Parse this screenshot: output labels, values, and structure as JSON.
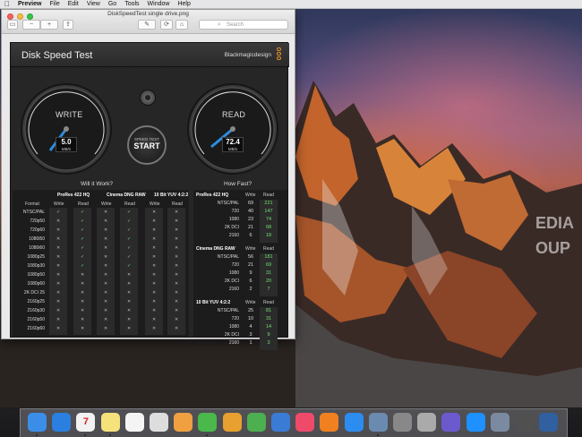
{
  "menubar": {
    "apple": "",
    "app": "Preview",
    "items": [
      "File",
      "Edit",
      "View",
      "Go",
      "Tools",
      "Window",
      "Help"
    ]
  },
  "window": {
    "title": "DiskSpeedTest single drive.png",
    "search_placeholder": "Search"
  },
  "dst": {
    "title": "Disk Speed Test",
    "brand": "Blackmagicdesign",
    "write": {
      "label": "WRITE",
      "value": "5.0",
      "unit": "MB/s"
    },
    "read": {
      "label": "READ",
      "value": "72.4",
      "unit": "MB/s"
    },
    "start": {
      "line1": "SPEED TEST",
      "line2": "START"
    },
    "will_it_work": "Will it Work?",
    "how_fast": "How Fast?",
    "format_label": "Format",
    "codecs": [
      "ProRes 422 HQ",
      "Cinema DNG RAW",
      "10 Bit YUV 4:2:2"
    ],
    "wr": [
      "Write",
      "Read"
    ],
    "formats": [
      "NTSC/PAL",
      "720p50",
      "720p60",
      "1080i50",
      "1080i60",
      "1080p25",
      "1080p30",
      "1080p50",
      "1080p60",
      "2K DCI 25",
      "2160p25",
      "2160p30",
      "2160p50",
      "2160p60"
    ],
    "how_fast_sections": [
      {
        "name": "ProRes 422 HQ",
        "rows": [
          [
            "NTSC/PAL",
            "69",
            "221"
          ],
          [
            "720",
            "40",
            "147"
          ],
          [
            "1080",
            "23",
            "74"
          ],
          [
            "2K DCI",
            "21",
            "68"
          ],
          [
            "2160",
            "6",
            "18"
          ]
        ]
      },
      {
        "name": "Cinema DNG RAW",
        "rows": [
          [
            "NTSC/PAL",
            "56",
            "181"
          ],
          [
            "720",
            "21",
            "69"
          ],
          [
            "1080",
            "9",
            "31"
          ],
          [
            "2K DCI",
            "6",
            "20"
          ],
          [
            "2160",
            "2",
            "7"
          ]
        ]
      },
      {
        "name": "10 Bit YUV 4:2:2",
        "rows": [
          [
            "NTSC/PAL",
            "25",
            "81"
          ],
          [
            "720",
            "10",
            "31"
          ],
          [
            "1080",
            "4",
            "14"
          ],
          [
            "2K DCI",
            "3",
            "9"
          ],
          [
            "2160",
            "1",
            "3"
          ]
        ]
      }
    ]
  },
  "watermark": {
    "lines": [
      "EDIA",
      "OUP"
    ]
  },
  "dock": {
    "apps": [
      "finder",
      "safari",
      "calendar",
      "notes",
      "reminders",
      "photos-viewer",
      "photos",
      "messages",
      "pages",
      "numbers",
      "keynote",
      "itunes",
      "ibooks",
      "app-store",
      "preview",
      "system-preferences",
      "directory-utility",
      "imovie",
      "teamviewer",
      "photo-tool",
      "screen-capture",
      "camera-tool"
    ],
    "calendar_day": "7"
  }
}
